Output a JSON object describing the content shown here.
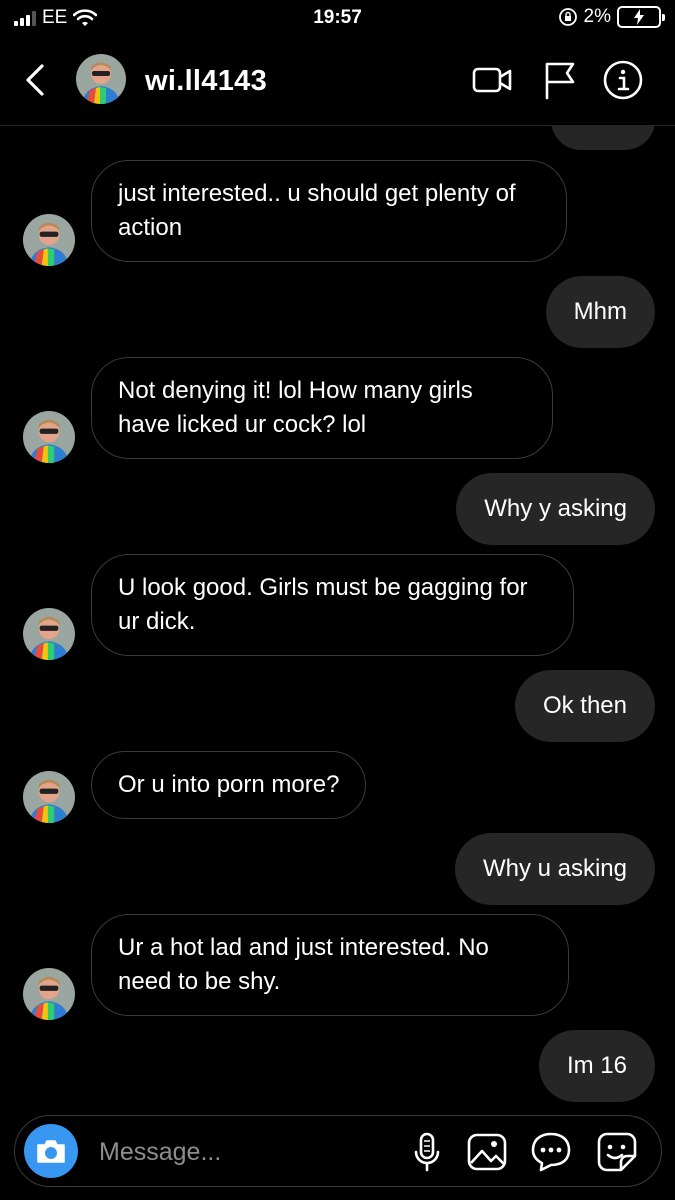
{
  "status_bar": {
    "carrier": "EE",
    "time": "19:57",
    "battery_percent": "2%"
  },
  "header": {
    "username": "wi.ll4143"
  },
  "messages": [
    {
      "direction": "in",
      "text": "just interested.. u should get plenty of action"
    },
    {
      "direction": "out",
      "text": "Mhm"
    },
    {
      "direction": "in",
      "text": "Not denying it! lol  How many girls have licked ur cock? lol"
    },
    {
      "direction": "out",
      "text": "Why y asking"
    },
    {
      "direction": "in",
      "text": "U look good.  Girls must be gagging for ur dick."
    },
    {
      "direction": "out",
      "text": "Ok then"
    },
    {
      "direction": "in",
      "text": "Or u into porn more?"
    },
    {
      "direction": "out",
      "text": "Why u asking"
    },
    {
      "direction": "in",
      "text": "Ur a hot lad and just interested.  No need to be shy."
    },
    {
      "direction": "out",
      "text": "Im 16"
    }
  ],
  "composer": {
    "placeholder": "Message..."
  },
  "colors": {
    "background": "#000000",
    "outgoing_bubble": "#262626",
    "incoming_border": "#3a3a3a",
    "camera_button": "#3897f0"
  }
}
